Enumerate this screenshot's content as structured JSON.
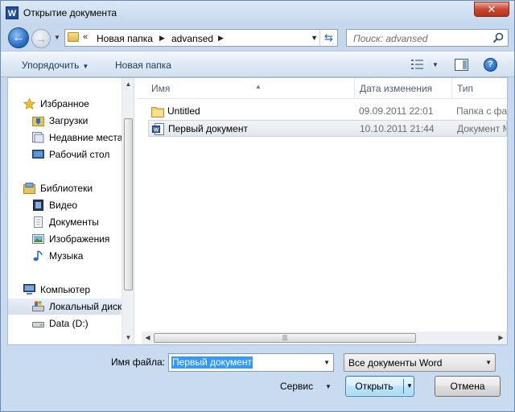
{
  "window": {
    "title": "Открытие документа",
    "app_icon_letter": "W",
    "close_glyph": "✕"
  },
  "address": {
    "overflow": "«",
    "segments": [
      "Новая папка",
      "advansed"
    ],
    "search_placeholder": "Поиск: advansed"
  },
  "toolbar": {
    "organize_label": "Упорядочить",
    "new_folder_label": "Новая папка",
    "help_glyph": "?"
  },
  "sidebar": {
    "items": [
      {
        "label": "Избранное",
        "icon": "star-icon",
        "group": true
      },
      {
        "label": "Загрузки",
        "icon": "downloads-folder-icon"
      },
      {
        "label": "Недавние места",
        "icon": "recent-places-icon"
      },
      {
        "label": "Рабочий стол",
        "icon": "desktop-icon"
      },
      {
        "label": "Библиотеки",
        "icon": "libraries-icon",
        "group": true
      },
      {
        "label": "Видео",
        "icon": "video-icon"
      },
      {
        "label": "Документы",
        "icon": "documents-icon"
      },
      {
        "label": "Изображения",
        "icon": "pictures-icon"
      },
      {
        "label": "Музыка",
        "icon": "music-icon"
      },
      {
        "label": "Компьютер",
        "icon": "computer-icon",
        "group": true
      },
      {
        "label": "Локальный диск",
        "icon": "local-disk-icon",
        "selected": true
      },
      {
        "label": "Data (D:)",
        "icon": "drive-icon"
      }
    ]
  },
  "filelist": {
    "columns": [
      "Имя",
      "Дата изменения",
      "Тип"
    ],
    "rows": [
      {
        "name": "Untitled",
        "date": "09.09.2011 22:01",
        "type": "Папка с файлами",
        "icon": "folder-icon"
      },
      {
        "name": "Первый документ",
        "date": "10.10.2011 21:44",
        "type": "Документ Microsoft Word",
        "icon": "word-document-icon",
        "selected": true
      }
    ]
  },
  "footer": {
    "filename_label": "Имя файла:",
    "filename_value": "Первый документ",
    "filetype_value": "Все документы Word",
    "service_label": "Сервис",
    "open_label": "Открыть",
    "cancel_label": "Отмена"
  },
  "colors": {
    "selection": "#3399ff",
    "toolbar_text": "#1e395b",
    "column_header_text": "#4c607a"
  }
}
